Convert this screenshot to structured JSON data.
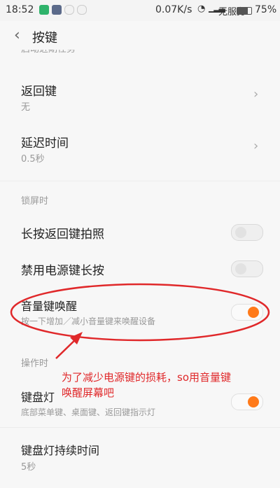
{
  "status": {
    "time": "18:52",
    "speed": "0.07K/s",
    "carrier": "无服务",
    "battery": "75%",
    "battery_level": 0.75,
    "notification_icons": [
      "app-icon-green",
      "app-icon-gray",
      "qq-icon",
      "qq-icon"
    ]
  },
  "header": {
    "title": "按键",
    "back_icon": "chevron-left-icon"
  },
  "cutoff_item": "启动近期任务",
  "rows": {
    "back_key": {
      "title": "返回键",
      "subtitle": "无"
    },
    "delay": {
      "title": "延迟时间",
      "subtitle": "0.5秒"
    },
    "lock_section": "锁屏时",
    "long_press_back": {
      "title": "长按返回键拍照",
      "on": false
    },
    "disable_power": {
      "title": "禁用电源键长按",
      "on": false
    },
    "volume_wake": {
      "title": "音量键唤醒",
      "subtitle": "按一下增加／减小音量键来唤醒设备",
      "on": true
    },
    "ops_section": "操作时",
    "key_light": {
      "title": "键盘灯",
      "subtitle": "底部菜单键、桌面键、返回键指示灯",
      "on": true
    },
    "key_light_duration": {
      "title": "键盘灯持续时间",
      "subtitle": "5秒"
    }
  },
  "annotation": {
    "line1": "为了减少电源键的损耗，so用音量键",
    "line2": "唤醒屏幕吧"
  },
  "colors": {
    "accent": "#ff7a1a",
    "annotation": "#e0282a"
  }
}
